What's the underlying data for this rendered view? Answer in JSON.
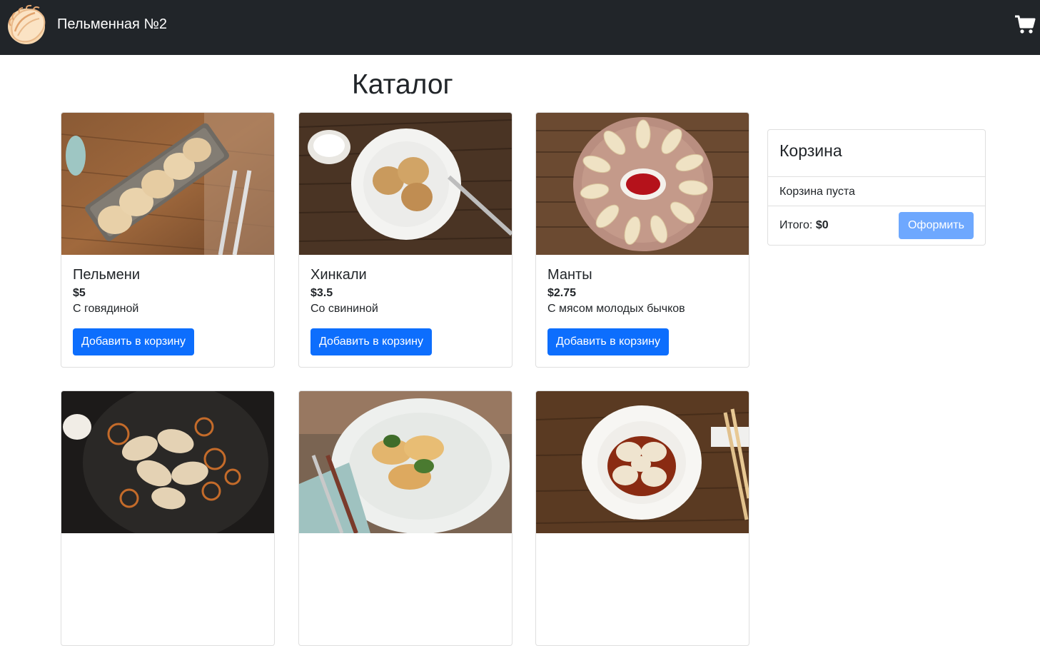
{
  "header": {
    "brand": "Пельменная №2",
    "logo_icon": "dumpling-logo-icon",
    "cart_icon": "shopping-cart-icon",
    "background": "#212529"
  },
  "catalog": {
    "title": "Каталог",
    "add_label": "Добавить в корзину",
    "button_color": "#0d6efd",
    "products": [
      {
        "name": "Пельмени",
        "price": "$5",
        "description": "С говядиной"
      },
      {
        "name": "Хинкали",
        "price": "$3.5",
        "description": "Со свининой"
      },
      {
        "name": "Манты",
        "price": "$2.75",
        "description": "С мясом молодых бычков"
      }
    ]
  },
  "cart": {
    "title": "Корзина",
    "empty_text": "Корзина пуста",
    "total_label": "Итого:",
    "total_value": "$0",
    "checkout_label": "Оформить",
    "checkout_color": "#6ea8fe"
  }
}
